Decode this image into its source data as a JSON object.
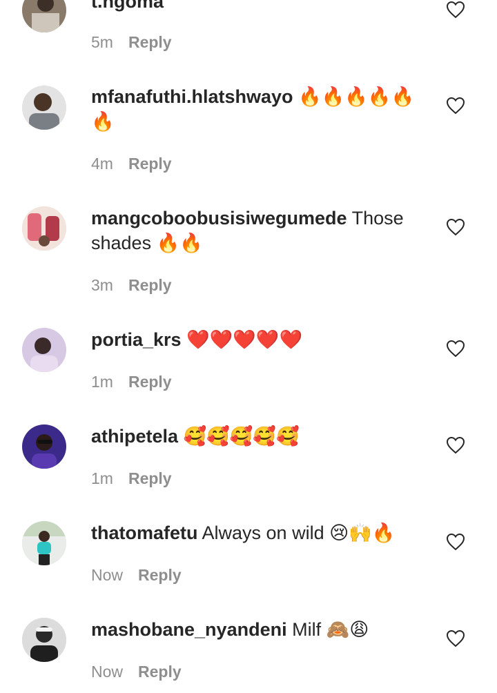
{
  "comments": [
    {
      "username": "t.ngoma",
      "text": "",
      "emoji": "",
      "time": "5m",
      "reply_label": "Reply"
    },
    {
      "username": "mfanafuthi.hlatshwayo",
      "text": "",
      "emoji": "🔥🔥🔥🔥🔥🔥",
      "time": "4m",
      "reply_label": "Reply"
    },
    {
      "username": "mangcoboobusisiwegumede",
      "text": "Those shades",
      "emoji": "🔥🔥",
      "time": "3m",
      "reply_label": "Reply"
    },
    {
      "username": "portia_krs",
      "text": "",
      "emoji": "❤️❤️❤️❤️❤️",
      "time": "1m",
      "reply_label": "Reply"
    },
    {
      "username": "athipetela",
      "text": "",
      "emoji": "🥰🥰🥰🥰🥰",
      "time": "1m",
      "reply_label": "Reply"
    },
    {
      "username": "thatomafetu",
      "text": "Always on wild",
      "emoji": "😢🙌🔥",
      "time": "Now",
      "reply_label": "Reply"
    },
    {
      "username": "mashobane_nyandeni",
      "text": "Milf",
      "emoji": "🙈😩",
      "time": "Now",
      "reply_label": "Reply"
    }
  ],
  "colors": {
    "text": "#262626",
    "secondary": "#8e8e8e",
    "background": "#ffffff"
  },
  "icons": {
    "like": "heart-outline-icon"
  }
}
